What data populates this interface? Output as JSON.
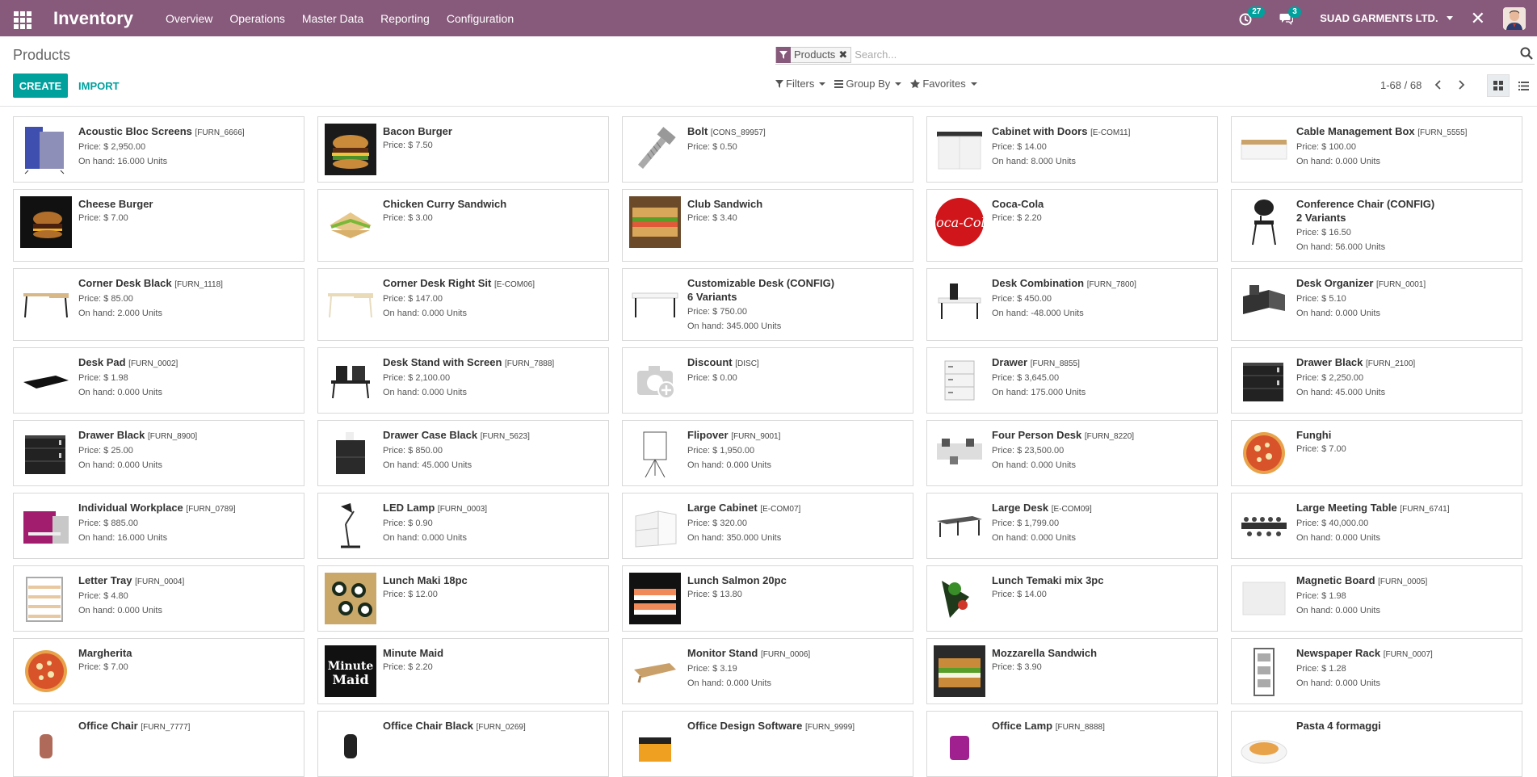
{
  "navbar": {
    "app_title": "Inventory",
    "menu": [
      "Overview",
      "Operations",
      "Master Data",
      "Reporting",
      "Configuration"
    ],
    "activity_count": "27",
    "message_count": "3",
    "company": "SUAD GARMENTS LTD."
  },
  "control": {
    "title": "Products",
    "facet_label": "Products",
    "search_placeholder": "Search...",
    "create_label": "CREATE",
    "import_label": "IMPORT",
    "filters_label": "Filters",
    "groupby_label": "Group By",
    "favorites_label": "Favorites",
    "pager": "1-68 / 68"
  },
  "colors": {
    "brand": "#875a7b",
    "accent": "#00a09d"
  },
  "products": [
    {
      "name": "Acoustic Bloc Screens",
      "code": "[FURN_6666]",
      "variants": "",
      "price": "Price: $ 2,950.00",
      "onhand": "On hand: 16.000 Units",
      "img": "screens"
    },
    {
      "name": "Bacon Burger",
      "code": "",
      "variants": "",
      "price": "Price: $ 7.50",
      "onhand": "",
      "img": "burger"
    },
    {
      "name": "Bolt",
      "code": "[CONS_89957]",
      "variants": "",
      "price": "Price: $ 0.50",
      "onhand": "",
      "img": "bolt"
    },
    {
      "name": "Cabinet with Doors",
      "code": "[E-COM11]",
      "variants": "",
      "price": "Price: $ 14.00",
      "onhand": "On hand: 8.000 Units",
      "img": "cabinet"
    },
    {
      "name": "Cable Management Box",
      "code": "[FURN_5555]",
      "variants": "",
      "price": "Price: $ 100.00",
      "onhand": "On hand: 0.000 Units",
      "img": "box"
    },
    {
      "name": "Cheese Burger",
      "code": "",
      "variants": "",
      "price": "Price: $ 7.00",
      "onhand": "",
      "img": "burger2"
    },
    {
      "name": "Chicken Curry Sandwich",
      "code": "",
      "variants": "",
      "price": "Price: $ 3.00",
      "onhand": "",
      "img": "sandwich"
    },
    {
      "name": "Club Sandwich",
      "code": "",
      "variants": "",
      "price": "Price: $ 3.40",
      "onhand": "",
      "img": "club"
    },
    {
      "name": "Coca-Cola",
      "code": "",
      "variants": "",
      "price": "Price: $ 2.20",
      "onhand": "",
      "img": "coke"
    },
    {
      "name": "Conference Chair (CONFIG)",
      "code": "",
      "variants": "2 Variants",
      "price": "Price: $ 16.50",
      "onhand": "On hand: 56.000 Units",
      "img": "chair"
    },
    {
      "name": "Corner Desk Black",
      "code": "[FURN_1118]",
      "variants": "",
      "price": "Price: $ 85.00",
      "onhand": "On hand: 2.000 Units",
      "img": "desk"
    },
    {
      "name": "Corner Desk Right Sit",
      "code": "[E-COM06]",
      "variants": "",
      "price": "Price: $ 147.00",
      "onhand": "On hand: 0.000 Units",
      "img": "desk2"
    },
    {
      "name": "Customizable Desk (CONFIG)",
      "code": "",
      "variants": "6 Variants",
      "price": "Price: $ 750.00",
      "onhand": "On hand: 345.000 Units",
      "img": "desk3"
    },
    {
      "name": "Desk Combination",
      "code": "[FURN_7800]",
      "variants": "",
      "price": "Price: $ 450.00",
      "onhand": "On hand: -48.000 Units",
      "img": "combo"
    },
    {
      "name": "Desk Organizer",
      "code": "[FURN_0001]",
      "variants": "",
      "price": "Price: $ 5.10",
      "onhand": "On hand: 0.000 Units",
      "img": "organizer"
    },
    {
      "name": "Desk Pad",
      "code": "[FURN_0002]",
      "variants": "",
      "price": "Price: $ 1.98",
      "onhand": "On hand: 0.000 Units",
      "img": "pad"
    },
    {
      "name": "Desk Stand with Screen",
      "code": "[FURN_7888]",
      "variants": "",
      "price": "Price: $ 2,100.00",
      "onhand": "On hand: 0.000 Units",
      "img": "stand"
    },
    {
      "name": "Discount",
      "code": "[DISC]",
      "variants": "",
      "price": "Price: $ 0.00",
      "onhand": "",
      "img": "camera"
    },
    {
      "name": "Drawer",
      "code": "[FURN_8855]",
      "variants": "",
      "price": "Price: $ 3,645.00",
      "onhand": "On hand: 175.000 Units",
      "img": "drawer"
    },
    {
      "name": "Drawer Black",
      "code": "[FURN_2100]",
      "variants": "",
      "price": "Price: $ 2,250.00",
      "onhand": "On hand: 45.000 Units",
      "img": "drawerblack"
    },
    {
      "name": "Drawer Black",
      "code": "[FURN_8900]",
      "variants": "",
      "price": "Price: $ 25.00",
      "onhand": "On hand: 0.000 Units",
      "img": "drawerblack"
    },
    {
      "name": "Drawer Case Black",
      "code": "[FURN_5623]",
      "variants": "",
      "price": "Price: $ 850.00",
      "onhand": "On hand: 45.000 Units",
      "img": "case"
    },
    {
      "name": "Flipover",
      "code": "[FURN_9001]",
      "variants": "",
      "price": "Price: $ 1,950.00",
      "onhand": "On hand: 0.000 Units",
      "img": "flip"
    },
    {
      "name": "Four Person Desk",
      "code": "[FURN_8220]",
      "variants": "",
      "price": "Price: $ 23,500.00",
      "onhand": "On hand: 0.000 Units",
      "img": "four"
    },
    {
      "name": "Funghi",
      "code": "",
      "variants": "",
      "price": "Price: $ 7.00",
      "onhand": "",
      "img": "pizza"
    },
    {
      "name": "Individual Workplace",
      "code": "[FURN_0789]",
      "variants": "",
      "price": "Price: $ 885.00",
      "onhand": "On hand: 16.000 Units",
      "img": "workplace"
    },
    {
      "name": "LED Lamp",
      "code": "[FURN_0003]",
      "variants": "",
      "price": "Price: $ 0.90",
      "onhand": "On hand: 0.000 Units",
      "img": "lamp"
    },
    {
      "name": "Large Cabinet",
      "code": "[E-COM07]",
      "variants": "",
      "price": "Price: $ 320.00",
      "onhand": "On hand: 350.000 Units",
      "img": "largecab"
    },
    {
      "name": "Large Desk",
      "code": "[E-COM09]",
      "variants": "",
      "price": "Price: $ 1,799.00",
      "onhand": "On hand: 0.000 Units",
      "img": "largedesk"
    },
    {
      "name": "Large Meeting Table",
      "code": "[FURN_6741]",
      "variants": "",
      "price": "Price: $ 40,000.00",
      "onhand": "On hand: 0.000 Units",
      "img": "meeting"
    },
    {
      "name": "Letter Tray",
      "code": "[FURN_0004]",
      "variants": "",
      "price": "Price: $ 4.80",
      "onhand": "On hand: 0.000 Units",
      "img": "tray"
    },
    {
      "name": "Lunch Maki 18pc",
      "code": "",
      "variants": "",
      "price": "Price: $ 12.00",
      "onhand": "",
      "img": "maki"
    },
    {
      "name": "Lunch Salmon 20pc",
      "code": "",
      "variants": "",
      "price": "Price: $ 13.80",
      "onhand": "",
      "img": "salmon"
    },
    {
      "name": "Lunch Temaki mix 3pc",
      "code": "",
      "variants": "",
      "price": "Price: $ 14.00",
      "onhand": "",
      "img": "temaki"
    },
    {
      "name": "Magnetic Board",
      "code": "[FURN_0005]",
      "variants": "",
      "price": "Price: $ 1.98",
      "onhand": "On hand: 0.000 Units",
      "img": "board"
    },
    {
      "name": "Margherita",
      "code": "",
      "variants": "",
      "price": "Price: $ 7.00",
      "onhand": "",
      "img": "pizza"
    },
    {
      "name": "Minute Maid",
      "code": "",
      "variants": "",
      "price": "Price: $ 2.20",
      "onhand": "",
      "img": "minutemaid"
    },
    {
      "name": "Monitor Stand",
      "code": "[FURN_0006]",
      "variants": "",
      "price": "Price: $ 3.19",
      "onhand": "On hand: 0.000 Units",
      "img": "monitor"
    },
    {
      "name": "Mozzarella Sandwich",
      "code": "",
      "variants": "",
      "price": "Price: $ 3.90",
      "onhand": "",
      "img": "mozz"
    },
    {
      "name": "Newspaper Rack",
      "code": "[FURN_0007]",
      "variants": "",
      "price": "Price: $ 1.28",
      "onhand": "On hand: 0.000 Units",
      "img": "rack"
    },
    {
      "name": "Office Chair",
      "code": "[FURN_7777]",
      "variants": "",
      "price": "",
      "onhand": "",
      "img": "officechair"
    },
    {
      "name": "Office Chair Black",
      "code": "[FURN_0269]",
      "variants": "",
      "price": "",
      "onhand": "",
      "img": "chairblack"
    },
    {
      "name": "Office Design Software",
      "code": "[FURN_9999]",
      "variants": "",
      "price": "",
      "onhand": "",
      "img": "software"
    },
    {
      "name": "Office Lamp",
      "code": "[FURN_8888]",
      "variants": "",
      "price": "",
      "onhand": "",
      "img": "officelamp"
    },
    {
      "name": "Pasta 4 formaggi",
      "code": "",
      "variants": "",
      "price": "",
      "onhand": "",
      "img": "pasta"
    }
  ]
}
